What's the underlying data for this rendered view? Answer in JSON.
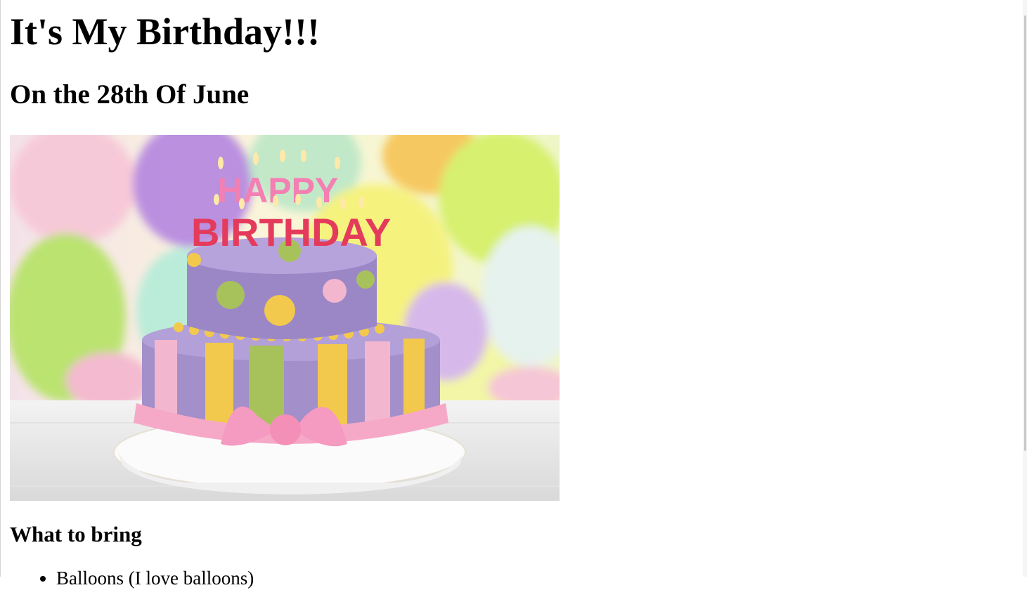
{
  "page": {
    "title": "It's My Birthday!!!",
    "subtitle": "On the 28th Of June",
    "image": {
      "alt": "Birthday cake with HAPPY BIRTHDAY candles",
      "candle_top": "HAPPY",
      "candle_bottom": "BIRTHDAY"
    },
    "section_heading": "What to bring",
    "items": [
      "Balloons (I love balloons)"
    ]
  },
  "colors": {
    "text": "#000000",
    "background": "#ffffff",
    "cake_purple": "#a38fc9",
    "cake_pink": "#f3b6cf",
    "cake_yellow": "#f2c94c",
    "cake_green": "#a8c25b"
  }
}
